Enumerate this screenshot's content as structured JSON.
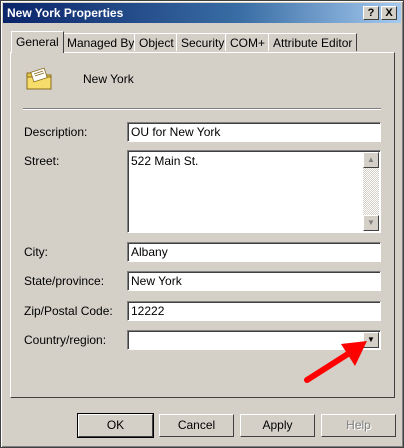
{
  "window": {
    "title": "New York Properties"
  },
  "titlebar_buttons": {
    "help": "?",
    "close": "X"
  },
  "tabs": [
    {
      "label": "General",
      "active": true
    },
    {
      "label": "Managed By",
      "active": false
    },
    {
      "label": "Object",
      "active": false
    },
    {
      "label": "Security",
      "active": false
    },
    {
      "label": "COM+",
      "active": false
    },
    {
      "label": "Attribute Editor",
      "active": false
    }
  ],
  "object": {
    "name": "New York",
    "icon": "organizational-unit-icon"
  },
  "form": {
    "description": {
      "label": "Description:",
      "value": "OU for New York"
    },
    "street": {
      "label": "Street:",
      "value": "522 Main St."
    },
    "city": {
      "label": "City:",
      "value": "Albany"
    },
    "state": {
      "label": "State/province:",
      "value": "New York"
    },
    "zip": {
      "label": "Zip/Postal Code:",
      "value": "12222"
    },
    "country": {
      "label": "Country/region:",
      "value": ""
    }
  },
  "buttons": {
    "ok": "OK",
    "cancel": "Cancel",
    "apply": "Apply",
    "help": "Help"
  },
  "colors": {
    "titlebar_start": "#0a246a",
    "titlebar_end": "#a6caf0",
    "dialog_bg": "#d4d0c8",
    "annotation_arrow": "#ff0000"
  }
}
